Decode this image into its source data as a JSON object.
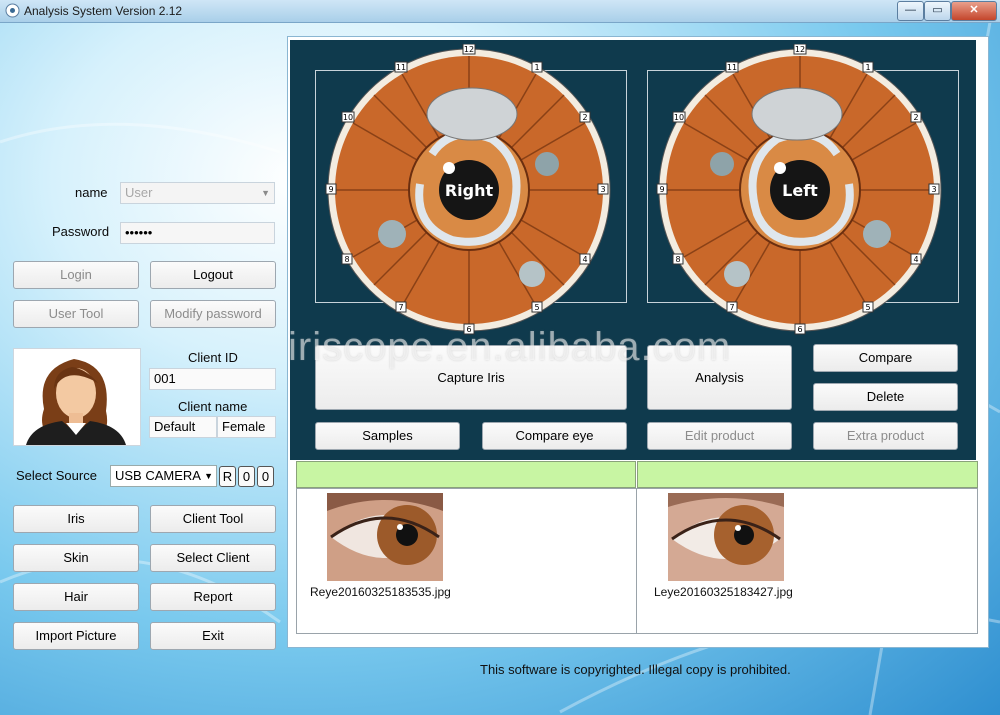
{
  "window": {
    "title": "Analysis System Version 2.12",
    "controls": {
      "minimize": "—",
      "maximize": "▭",
      "close": "✕"
    }
  },
  "login": {
    "name_label": "name",
    "name_value": "User",
    "password_label": "Password",
    "password_value": "••••••"
  },
  "buttons": {
    "login": "Login",
    "logout": "Logout",
    "user_tool": "User Tool",
    "modify_password": "Modify password",
    "iris": "Iris",
    "client_tool": "Client Tool",
    "skin": "Skin",
    "select_client": "Select Client",
    "hair": "Hair",
    "report": "Report",
    "import_picture": "Import Picture",
    "exit": "Exit"
  },
  "client": {
    "id_label": "Client ID",
    "id_value": "001",
    "name_label": "Client name",
    "name_value": "Default",
    "gender_value": "Female"
  },
  "source": {
    "label": "Select Source",
    "value": "USB CAMERA",
    "r_label": "R",
    "zero_a": "0",
    "zero_b": "0"
  },
  "iris_charts": {
    "right": {
      "label": "Right",
      "numbers": [
        "12",
        "1",
        "2",
        "3",
        "4",
        "5",
        "6",
        "7",
        "8",
        "9",
        "10",
        "11"
      ]
    },
    "left": {
      "label": "Left",
      "numbers": [
        "12",
        "1",
        "2",
        "3",
        "4",
        "5",
        "6",
        "7",
        "8",
        "9",
        "10",
        "11"
      ]
    }
  },
  "actions": {
    "capture_iris": "Capture Iris",
    "analysis": "Analysis",
    "compare": "Compare",
    "delete": "Delete",
    "samples": "Samples",
    "compare_eye": "Compare eye",
    "edit_product": "Edit product",
    "extra_product": "Extra product"
  },
  "images": {
    "right_file": "Reye20160325183535.jpg",
    "left_file": "Leye20160325183427.jpg"
  },
  "watermark": "iriscope.en.alibaba.com",
  "footer": "This software is copyrighted. Illegal copy is prohibited.",
  "colors": {
    "panel_dark": "#0f3a4d",
    "iris_orange": "#c9682a",
    "header_green": "#c8f5a3",
    "iris_brown": "#9c5a2a"
  }
}
